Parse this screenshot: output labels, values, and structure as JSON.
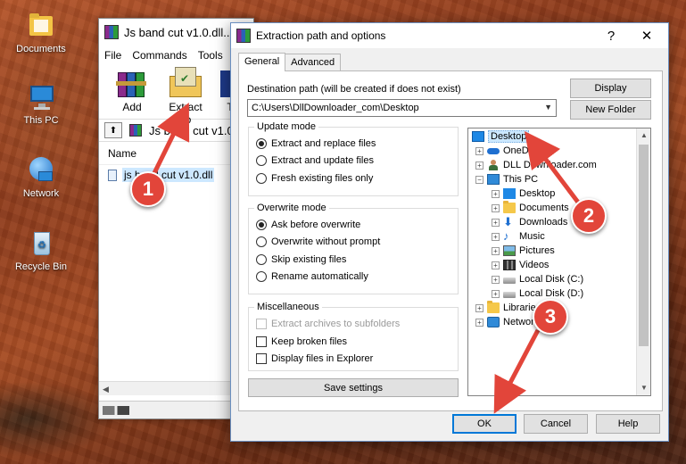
{
  "desktop": {
    "icons": [
      {
        "label": "Documents"
      },
      {
        "label": "This PC"
      },
      {
        "label": "Network"
      },
      {
        "label": "Recycle Bin"
      }
    ]
  },
  "rar_window": {
    "title": "Js band cut v1.0.dll...",
    "menu": [
      "File",
      "Commands",
      "Tools"
    ],
    "toolbar": {
      "add": "Add",
      "extract_to": "Extract To",
      "partial": "T"
    },
    "address": "Js band cut v1.0...",
    "column_name": "Name",
    "file_label": "js band cut v1.0.dll"
  },
  "dialog": {
    "title": "Extraction path and options",
    "help_glyph": "?",
    "close_glyph": "✕",
    "tabs": {
      "general": "General",
      "advanced": "Advanced"
    },
    "destination_label": "Destination path (will be created if does not exist)",
    "destination_value": "C:\\Users\\DllDownloader_com\\Desktop",
    "display_button": "Display",
    "new_folder_button": "New Folder",
    "update_mode": {
      "title": "Update mode",
      "options": [
        "Extract and replace files",
        "Extract and update files",
        "Fresh existing files only"
      ],
      "selected": 0
    },
    "overwrite_mode": {
      "title": "Overwrite mode",
      "options": [
        "Ask before overwrite",
        "Overwrite without prompt",
        "Skip existing files",
        "Rename automatically"
      ],
      "selected": 0
    },
    "misc": {
      "title": "Miscellaneous",
      "extract_subfolders": "Extract archives to subfolders",
      "keep_broken": "Keep broken files",
      "display_in_explorer": "Display files in Explorer"
    },
    "save_settings": "Save settings",
    "tree": {
      "desktop": "Desktop",
      "onedrive": "OneDrive",
      "user": "DLL Downloader.com",
      "this_pc": "This PC",
      "pc_desktop": "Desktop",
      "documents": "Documents",
      "downloads": "Downloads",
      "music": "Music",
      "pictures": "Pictures",
      "videos": "Videos",
      "local_c": "Local Disk (C:)",
      "local_d": "Local Disk (D:)",
      "libraries": "Libraries",
      "network": "Network"
    },
    "ok_button": "OK",
    "cancel_button": "Cancel",
    "help_button": "Help"
  },
  "annotations": {
    "badge1": "1",
    "badge2": "2",
    "badge3": "3",
    "color": "#e2453a"
  }
}
